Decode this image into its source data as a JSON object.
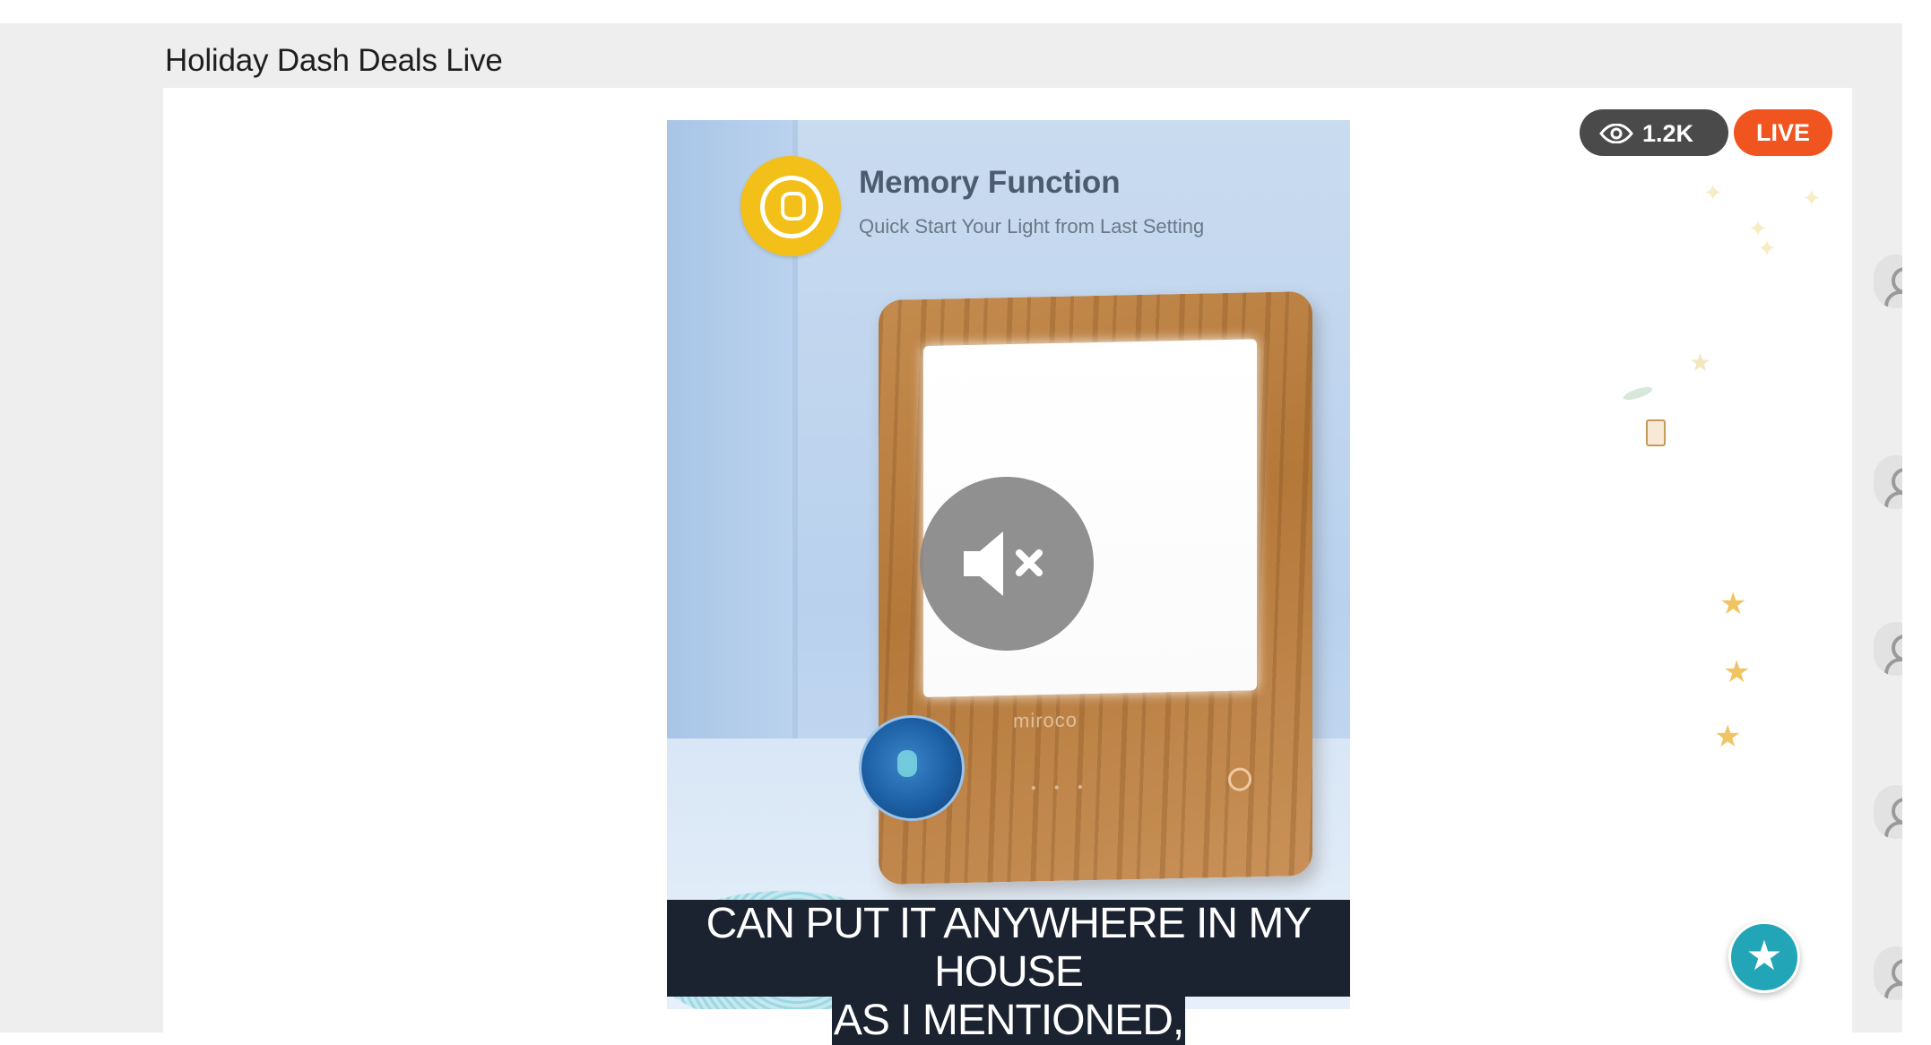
{
  "header": {
    "title": "Holiday Dash Deals Live"
  },
  "stream": {
    "viewer_count": "1.2K",
    "live_label": "LIVE",
    "muted": true
  },
  "video_frame": {
    "feature_title": "Memory Function",
    "feature_subtitle": "Quick Start Your Light from Last Setting",
    "brand_mark": "miroco"
  },
  "captions": {
    "line1": "CAN PUT IT ANYWHERE IN MY HOUSE",
    "line2": "AS I MENTIONED,"
  },
  "icons": {
    "viewers": "eye-icon",
    "mute": "speaker-muted-icon",
    "favorite": "star-icon",
    "avatar": "user-avatar-icon"
  },
  "colors": {
    "live_badge": "#f0551f",
    "viewer_badge": "#4a4a4a",
    "favorite_button": "#23a5b8",
    "feature_icon": "#f2c018"
  }
}
